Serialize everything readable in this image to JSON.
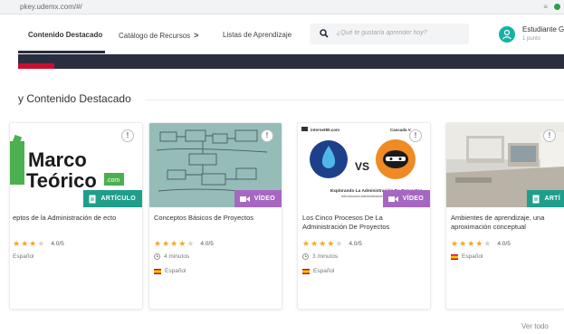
{
  "browser": {
    "url": "pkey.udemx.com/#/",
    "icon": "extension-icon"
  },
  "nav": {
    "items": [
      {
        "label": "Contenido Destacado",
        "active": true
      },
      {
        "label": "Catálogo de Recursos",
        "has_chevron": true
      },
      {
        "label": "Listas de Aprendizaje"
      }
    ],
    "chevron": ">",
    "search": {
      "placeholder": "¿Qué te gustaría aprender hoy?"
    },
    "user": {
      "name": "Estudiante G",
      "points": "1 punto"
    }
  },
  "colors": {
    "banner": "#2b2e3f",
    "accent": "#c8102e",
    "articulo": "#1f9e8c",
    "video": "#a667c2",
    "star": "#f5a623",
    "avatar": "#16b2a4"
  },
  "section": {
    "title": "y Contenido Destacado",
    "see_all": "Ver todo"
  },
  "cards": [
    {
      "type_label": "ARTÍCULO",
      "type": "articulo",
      "thumb_text": [
        "Marco",
        "Teórico",
        ".com"
      ],
      "title": "eptos de la Administración de ecto",
      "rating": 4,
      "rating_text": "4.0/5",
      "language": "Español"
    },
    {
      "type_label": "VÍDEO",
      "type": "video",
      "title": "Conceptos Básicos de Proyectos",
      "rating": 4,
      "rating_text": "4.0/5",
      "duration": "4 minutos",
      "language": "Español"
    },
    {
      "type_label": "VÍDEO",
      "type": "video",
      "thumb_text": [
        "internet80.com",
        "Cascada V",
        "VS",
        "Explorando La Administración De Proyectos",
        "Introducción Administración De..."
      ],
      "title": "Los Cinco Procesos De La Administración De Proyectos",
      "rating": 4,
      "rating_text": "4.0/5",
      "duration": "3 minutos",
      "language": "Español"
    },
    {
      "type_label": "ARTÍ",
      "type": "articulo",
      "title": "Ambientes de aprendizaje, una aproximación conceptual",
      "rating": 4,
      "rating_text": "4.0/5",
      "language": "Español"
    }
  ]
}
